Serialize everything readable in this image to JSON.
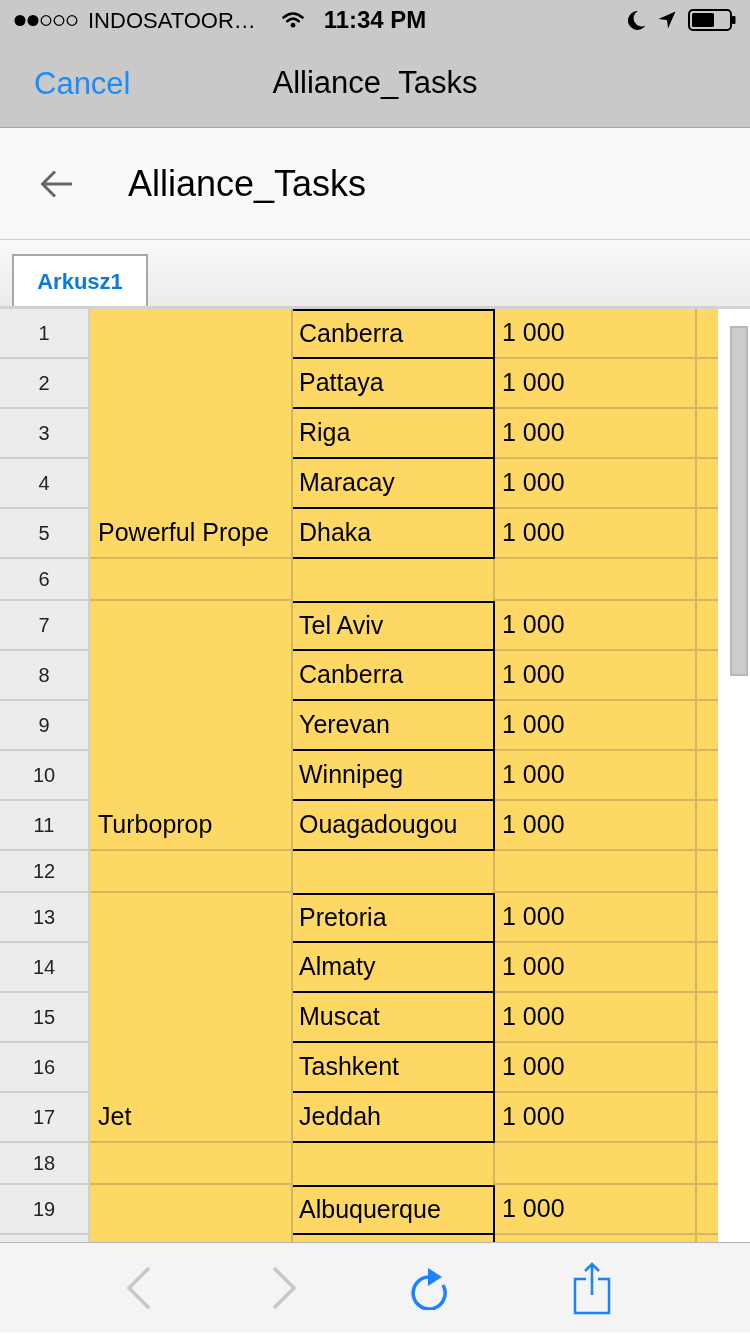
{
  "status_bar": {
    "carrier": "INDOSATOOR…",
    "time": "11:34 PM"
  },
  "nav_bar": {
    "cancel_button": "Cancel",
    "title": "Alliance_Tasks"
  },
  "header": {
    "title": "Alliance_Tasks"
  },
  "sheet_tabs": [
    {
      "label": "Arkusz1",
      "selected": true
    }
  ],
  "sheet": {
    "blocks": [
      {
        "column_a": "Powerful Prope",
        "rows": [
          {
            "kind": "entry",
            "number": "1",
            "column_b": "Canberra",
            "column_c": "1 000"
          },
          {
            "kind": "entry",
            "number": "2",
            "column_b": "Pattaya",
            "column_c": "1 000"
          },
          {
            "kind": "entry",
            "number": "3",
            "column_b": "Riga",
            "column_c": "1 000"
          },
          {
            "kind": "entry",
            "number": "4",
            "column_b": "Maracay",
            "column_c": "1 000"
          },
          {
            "kind": "entry",
            "number": "5",
            "column_b": "Dhaka",
            "column_c": "1 000"
          }
        ]
      },
      {
        "rows": [
          {
            "kind": "blank",
            "number": "6"
          }
        ]
      },
      {
        "column_a": "Turboprop",
        "rows": [
          {
            "kind": "entry",
            "number": "7",
            "column_b": "Tel Aviv",
            "column_c": "1 000"
          },
          {
            "kind": "entry",
            "number": "8",
            "column_b": "Canberra",
            "column_c": "1 000"
          },
          {
            "kind": "entry",
            "number": "9",
            "column_b": "Yerevan",
            "column_c": "1 000"
          },
          {
            "kind": "entry",
            "number": "10",
            "column_b": "Winnipeg",
            "column_c": "1 000"
          },
          {
            "kind": "entry",
            "number": "11",
            "column_b": "Ouagadougou",
            "column_c": "1 000"
          }
        ]
      },
      {
        "rows": [
          {
            "kind": "blank",
            "number": "12"
          }
        ]
      },
      {
        "column_a": "Jet",
        "rows": [
          {
            "kind": "entry",
            "number": "13",
            "column_b": "Pretoria",
            "column_c": "1 000"
          },
          {
            "kind": "entry",
            "number": "14",
            "column_b": "Almaty",
            "column_c": "1 000"
          },
          {
            "kind": "entry",
            "number": "15",
            "column_b": "Muscat",
            "column_c": "1 000"
          },
          {
            "kind": "entry",
            "number": "16",
            "column_b": "Tashkent",
            "column_c": "1 000"
          },
          {
            "kind": "entry",
            "number": "17",
            "column_b": "Jeddah",
            "column_c": "1 000"
          }
        ]
      },
      {
        "rows": [
          {
            "kind": "blank",
            "number": "18"
          }
        ]
      },
      {
        "rows": [
          {
            "kind": "entry",
            "number": "19",
            "column_b": "Albuquerque",
            "column_c": "1 000"
          },
          {
            "kind": "entry"
          }
        ]
      }
    ]
  },
  "toolbar": [
    {
      "kind": "back",
      "disabled": true
    },
    {
      "kind": "forward",
      "disabled": true
    },
    {
      "kind": "refresh",
      "disabled": false
    },
    {
      "kind": "share",
      "disabled": false
    }
  ]
}
